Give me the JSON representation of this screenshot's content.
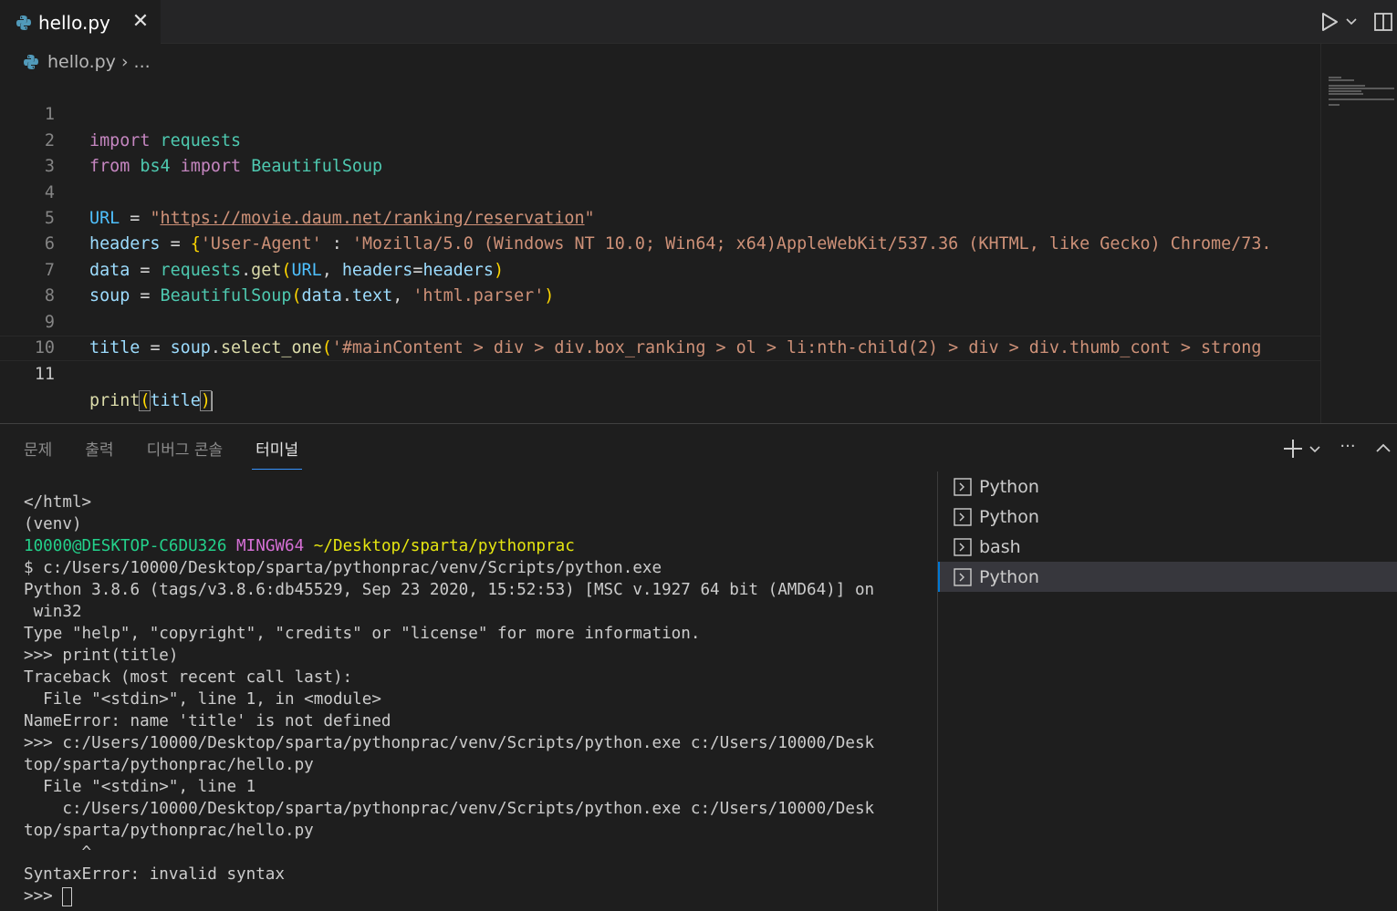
{
  "tab": {
    "title": "hello.py",
    "close": "✕"
  },
  "breadcrumb": {
    "file": "hello.py",
    "separator": "›",
    "more": "..."
  },
  "editor": {
    "line_numbers": [
      "1",
      "2",
      "3",
      "4",
      "5",
      "6",
      "7",
      "8",
      "9",
      "10",
      "11"
    ],
    "line1": {
      "kw_import": "import",
      "mod_requests": "requests"
    },
    "line2": {
      "kw_from": "from",
      "mod_bs4": "bs4",
      "kw_import": "import",
      "cls": "BeautifulSoup"
    },
    "line4": {
      "var": "URL",
      "op": " = ",
      "q1": "\"",
      "url": "https://movie.daum.net/ranking/reservation",
      "q2": "\""
    },
    "line5": {
      "var": "headers",
      "op": " = ",
      "brace": "{",
      "str_key": "'User-Agent'",
      "colon": " : ",
      "str_val": "'Mozilla/5.0 (Windows NT 10.0; Win64; x64)AppleWebKit/537.36 (KHTML, like Gecko) Chrome/73."
    },
    "line6": {
      "var": "data",
      "op": " = ",
      "mod": "requests",
      "dot": ".",
      "fn": "get",
      "p1": "(",
      "arg1": "URL",
      "comma": ", ",
      "kwarg": "headers",
      "eq": "=",
      "arg2": "headers",
      "p2": ")"
    },
    "line7": {
      "var": "soup",
      "op": " = ",
      "cls": "BeautifulSoup",
      "p1": "(",
      "arg1": "data",
      "dot": ".",
      "attr": "text",
      "comma": ", ",
      "str": "'html.parser'",
      "p2": ")"
    },
    "line9": {
      "var": "title",
      "op": " = ",
      "obj": "soup",
      "dot": ".",
      "fn": "select_one",
      "p1": "(",
      "str": "'#mainContent > div > div.box_ranking > ol > li:nth-child(2) > div > div.thumb_cont > strong"
    },
    "line11": {
      "fn": "print",
      "p1": "(",
      "arg": "title",
      "p2": ")"
    }
  },
  "panel": {
    "tabs": [
      "문제",
      "출력",
      "디버그 콘솔",
      "터미널"
    ],
    "active_tab": "터미널",
    "more": "···"
  },
  "terminal": {
    "lines": [
      "</html>",
      "(venv)",
      "",
      "$ c:/Users/10000/Desktop/sparta/pythonprac/venv/Scripts/python.exe",
      "Python 3.8.6 (tags/v3.8.6:db45529, Sep 23 2020, 15:52:53) [MSC v.1927 64 bit (AMD64)] on",
      " win32",
      "Type \"help\", \"copyright\", \"credits\" or \"license\" for more information.",
      ">>> print(title)",
      "Traceback (most recent call last):",
      "  File \"<stdin>\", line 1, in <module>",
      "NameError: name 'title' is not defined",
      ">>> c:/Users/10000/Desktop/sparta/pythonprac/venv/Scripts/python.exe c:/Users/10000/Desk",
      "top/sparta/pythonprac/hello.py",
      "  File \"<stdin>\", line 1",
      "    c:/Users/10000/Desktop/sparta/pythonprac/venv/Scripts/python.exe c:/Users/10000/Desk",
      "top/sparta/pythonprac/hello.py",
      "      ^",
      "SyntaxError: invalid syntax"
    ],
    "prompt_user": "10000@DESKTOP-C6DU326",
    "prompt_env": "MINGW64",
    "prompt_path": "~/Desktop/sparta/pythonprac",
    "last_prompt": ">>> "
  },
  "terminal_list": [
    {
      "label": "Python",
      "selected": false
    },
    {
      "label": "Python",
      "selected": false
    },
    {
      "label": "bash",
      "selected": false
    },
    {
      "label": "Python",
      "selected": true
    }
  ],
  "colors": {
    "python_icon": "#519aba",
    "accent": "#0078d4",
    "prompt_green": "#23d18b",
    "prompt_magenta": "#d670d6",
    "prompt_yellow": "#e5e510"
  },
  "icons": {
    "file": "python-icon",
    "run": "play-icon",
    "split": "split-editor-icon",
    "add": "plus-icon",
    "collapse": "chevron-up-icon",
    "terminal": "terminal-icon"
  }
}
